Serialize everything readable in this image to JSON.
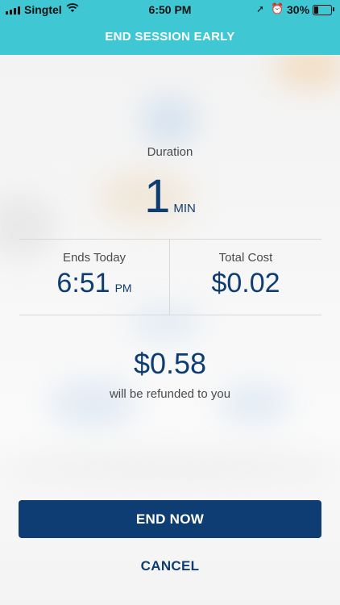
{
  "status_bar": {
    "carrier": "Singtel",
    "time": "6:50 PM",
    "battery_percent": "30%",
    "battery_level": 0.3,
    "icons": [
      "signal-icon",
      "wifi-icon",
      "location-icon",
      "alarm-icon",
      "battery-icon"
    ]
  },
  "header": {
    "title": "END SESSION EARLY"
  },
  "duration": {
    "label": "Duration",
    "value": "1",
    "unit": "MIN"
  },
  "ends": {
    "label": "Ends Today",
    "time": "6:51",
    "ampm": "PM"
  },
  "cost": {
    "label": "Total Cost",
    "value": "$0.02"
  },
  "refund": {
    "amount": "$0.58",
    "text": "will be refunded to you"
  },
  "actions": {
    "end_now": "END NOW",
    "cancel": "CANCEL"
  },
  "colors": {
    "header": "#3fc8d4",
    "primary": "#0e3d74"
  }
}
